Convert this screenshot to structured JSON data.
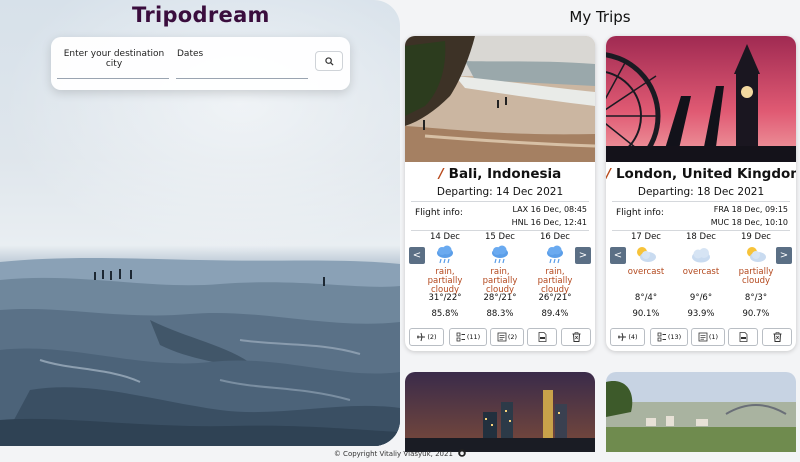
{
  "brand": "Tripodream",
  "search": {
    "destination_label": "Enter your destination city",
    "dates_label": "Dates"
  },
  "my_trips_title": "My Trips",
  "trips": [
    {
      "city": "Bali, Indonesia",
      "departing": "Departing: 14 Dec 2021",
      "flight_info_label": "Flight info:",
      "flights": [
        "LAX 16 Dec, 08:45",
        "HNL 16 Dec, 12:41"
      ],
      "weather": [
        {
          "date": "14 Dec",
          "icon": "rain-cloud-icon",
          "desc": "rain, partially cloudy",
          "temp": "31°/22°",
          "humidity": "85.8%"
        },
        {
          "date": "15 Dec",
          "icon": "rain-cloud-icon",
          "desc": "rain, partially cloudy",
          "temp": "28°/21°",
          "humidity": "88.3%"
        },
        {
          "date": "16 Dec",
          "icon": "rain-cloud-icon",
          "desc": "rain, partially cloudy",
          "temp": "26°/21°",
          "humidity": "89.4%"
        }
      ],
      "actions": {
        "flights_count": "(2)",
        "checklist_count": "(11)",
        "notes_count": "(2)"
      }
    },
    {
      "city": "London, United Kingdom",
      "departing": "Departing: 18 Dec 2021",
      "flight_info_label": "Flight info:",
      "flights": [
        "FRA 18 Dec, 09:15",
        "MUC 18 Dec, 10:10"
      ],
      "weather": [
        {
          "date": "17 Dec",
          "icon": "sun-cloud-icon",
          "desc": "overcast",
          "temp": "8°/4°",
          "humidity": "90.1%"
        },
        {
          "date": "18 Dec",
          "icon": "cloud-icon",
          "desc": "overcast",
          "temp": "9°/6°",
          "humidity": "93.9%"
        },
        {
          "date": "19 Dec",
          "icon": "sun-cloud-icon",
          "desc": "partially cloudy",
          "temp": "8°/3°",
          "humidity": "90.7%"
        }
      ],
      "actions": {
        "flights_count": "(4)",
        "checklist_count": "(13)",
        "notes_count": "(1)"
      }
    }
  ],
  "nav": {
    "prev": "<",
    "next": ">"
  },
  "footer": "© Copyright Vitaliy Vlasyuk, 2021",
  "colors": {
    "accent": "#b3481d",
    "nav": "#5b6f85",
    "brand": "#3a0d3d"
  }
}
